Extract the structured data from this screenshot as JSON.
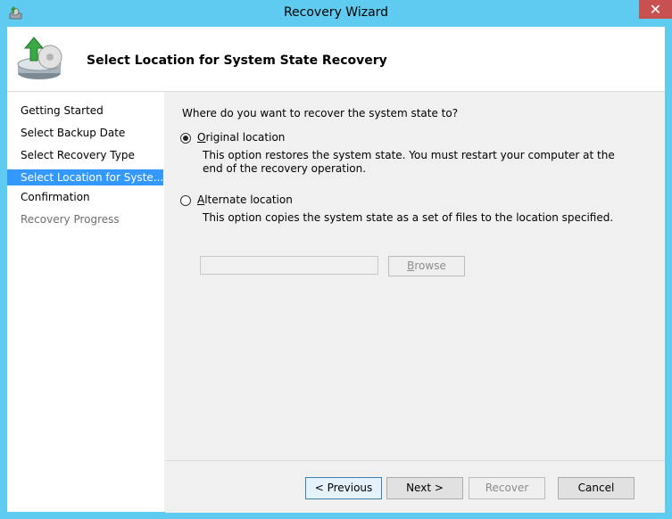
{
  "window": {
    "title": "Recovery Wizard",
    "close_glyph": "✕"
  },
  "header": {
    "title": "Select Location for System State Recovery",
    "icon": "backup-restore-icon"
  },
  "nav": {
    "items": [
      {
        "label": "Getting Started",
        "state": "normal"
      },
      {
        "label": "Select Backup Date",
        "state": "normal"
      },
      {
        "label": "Select Recovery Type",
        "state": "normal"
      },
      {
        "label": "Select Location for Syste...",
        "state": "active"
      },
      {
        "label": "Confirmation",
        "state": "normal"
      },
      {
        "label": "Recovery Progress",
        "state": "disabled"
      }
    ]
  },
  "content": {
    "question": "Where do you want to recover the system state to?",
    "original": {
      "label_accel": "O",
      "label_rest": "riginal location",
      "desc": "This option restores the system state. You must restart your computer at the end of the recovery operation.",
      "checked": true
    },
    "alternate": {
      "label_accel": "A",
      "label_rest": "lternate location",
      "desc": "This option copies the system state as a set of files to the location specified.",
      "checked": false
    },
    "path_value": "",
    "browse_accel": "B",
    "browse_rest": "rowse"
  },
  "footer": {
    "previous": "< Previous",
    "next": "Next >",
    "recover": "Recover",
    "cancel": "Cancel"
  }
}
